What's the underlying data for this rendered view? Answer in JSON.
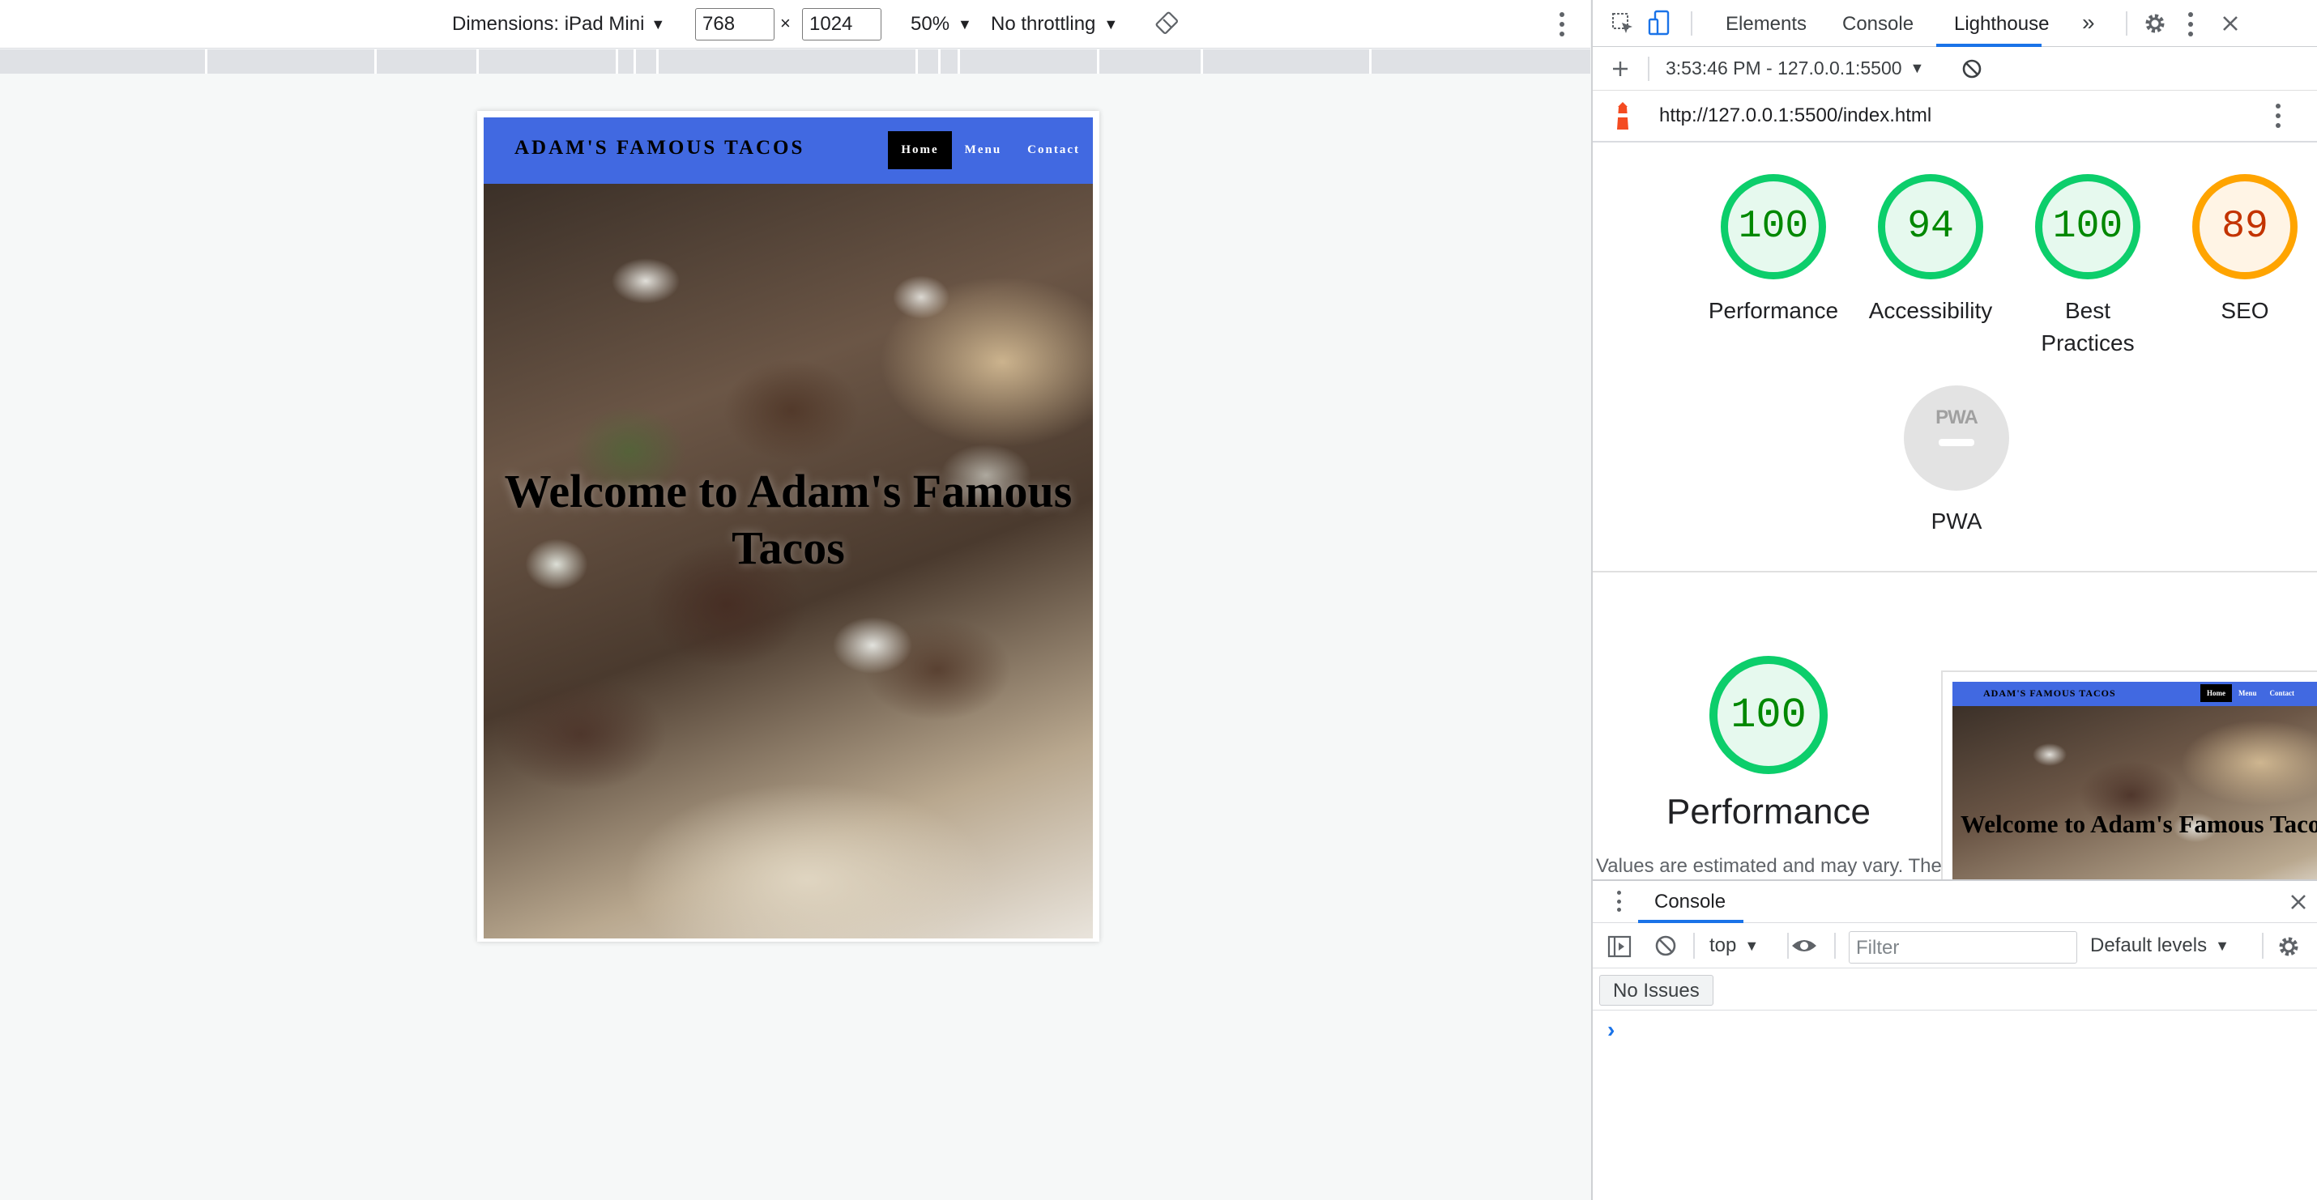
{
  "device_toolbar": {
    "dimensions_label": "Dimensions: iPad Mini",
    "width_value": "768",
    "times": "×",
    "height_value": "1024",
    "zoom": "50%",
    "throttling": "No throttling",
    "caret": "▼"
  },
  "site": {
    "brand": "ADAM'S FAMOUS TACOS",
    "nav": [
      "Home",
      "Menu",
      "Contact"
    ],
    "hero_title": "Welcome to Adam's Famous Tacos",
    "header_color": "#4169e1"
  },
  "devtools": {
    "tabs": [
      "Elements",
      "Console",
      "Lighthouse"
    ],
    "active_tab": "Lighthouse",
    "more_tabs": "»",
    "report_select": "3:53:46 PM - 127.0.0.1:5500",
    "url": "http://127.0.0.1:5500/index.html",
    "scores": [
      {
        "label": "Performance",
        "value": "100",
        "status": "pass"
      },
      {
        "label": "Accessibility",
        "value": "94",
        "status": "pass"
      },
      {
        "label": "Best Practices",
        "value": "100",
        "status": "pass"
      },
      {
        "label": "SEO",
        "value": "89",
        "status": "average"
      }
    ],
    "score_values": [
      100,
      94,
      100,
      89
    ],
    "pwa_badge_text": "PWA",
    "pwa_label": "PWA",
    "detail_score": "100",
    "detail_label": "Performance",
    "values_note": "Values are estimated and may vary. The",
    "thumbnail": {
      "brand": "ADAM'S FAMOUS TACOS",
      "nav": [
        "Home",
        "Menu",
        "Contact"
      ],
      "title": "Welcome to Adam's Famous Tacos"
    },
    "colors": {
      "pass": "#0cce6b",
      "average": "#ffa400",
      "accent": "#1a73e8"
    }
  },
  "console_drawer": {
    "tab": "Console",
    "context": "top",
    "filter_placeholder": "Filter",
    "levels": "Default levels",
    "issues": "No Issues",
    "prompt": "›"
  }
}
